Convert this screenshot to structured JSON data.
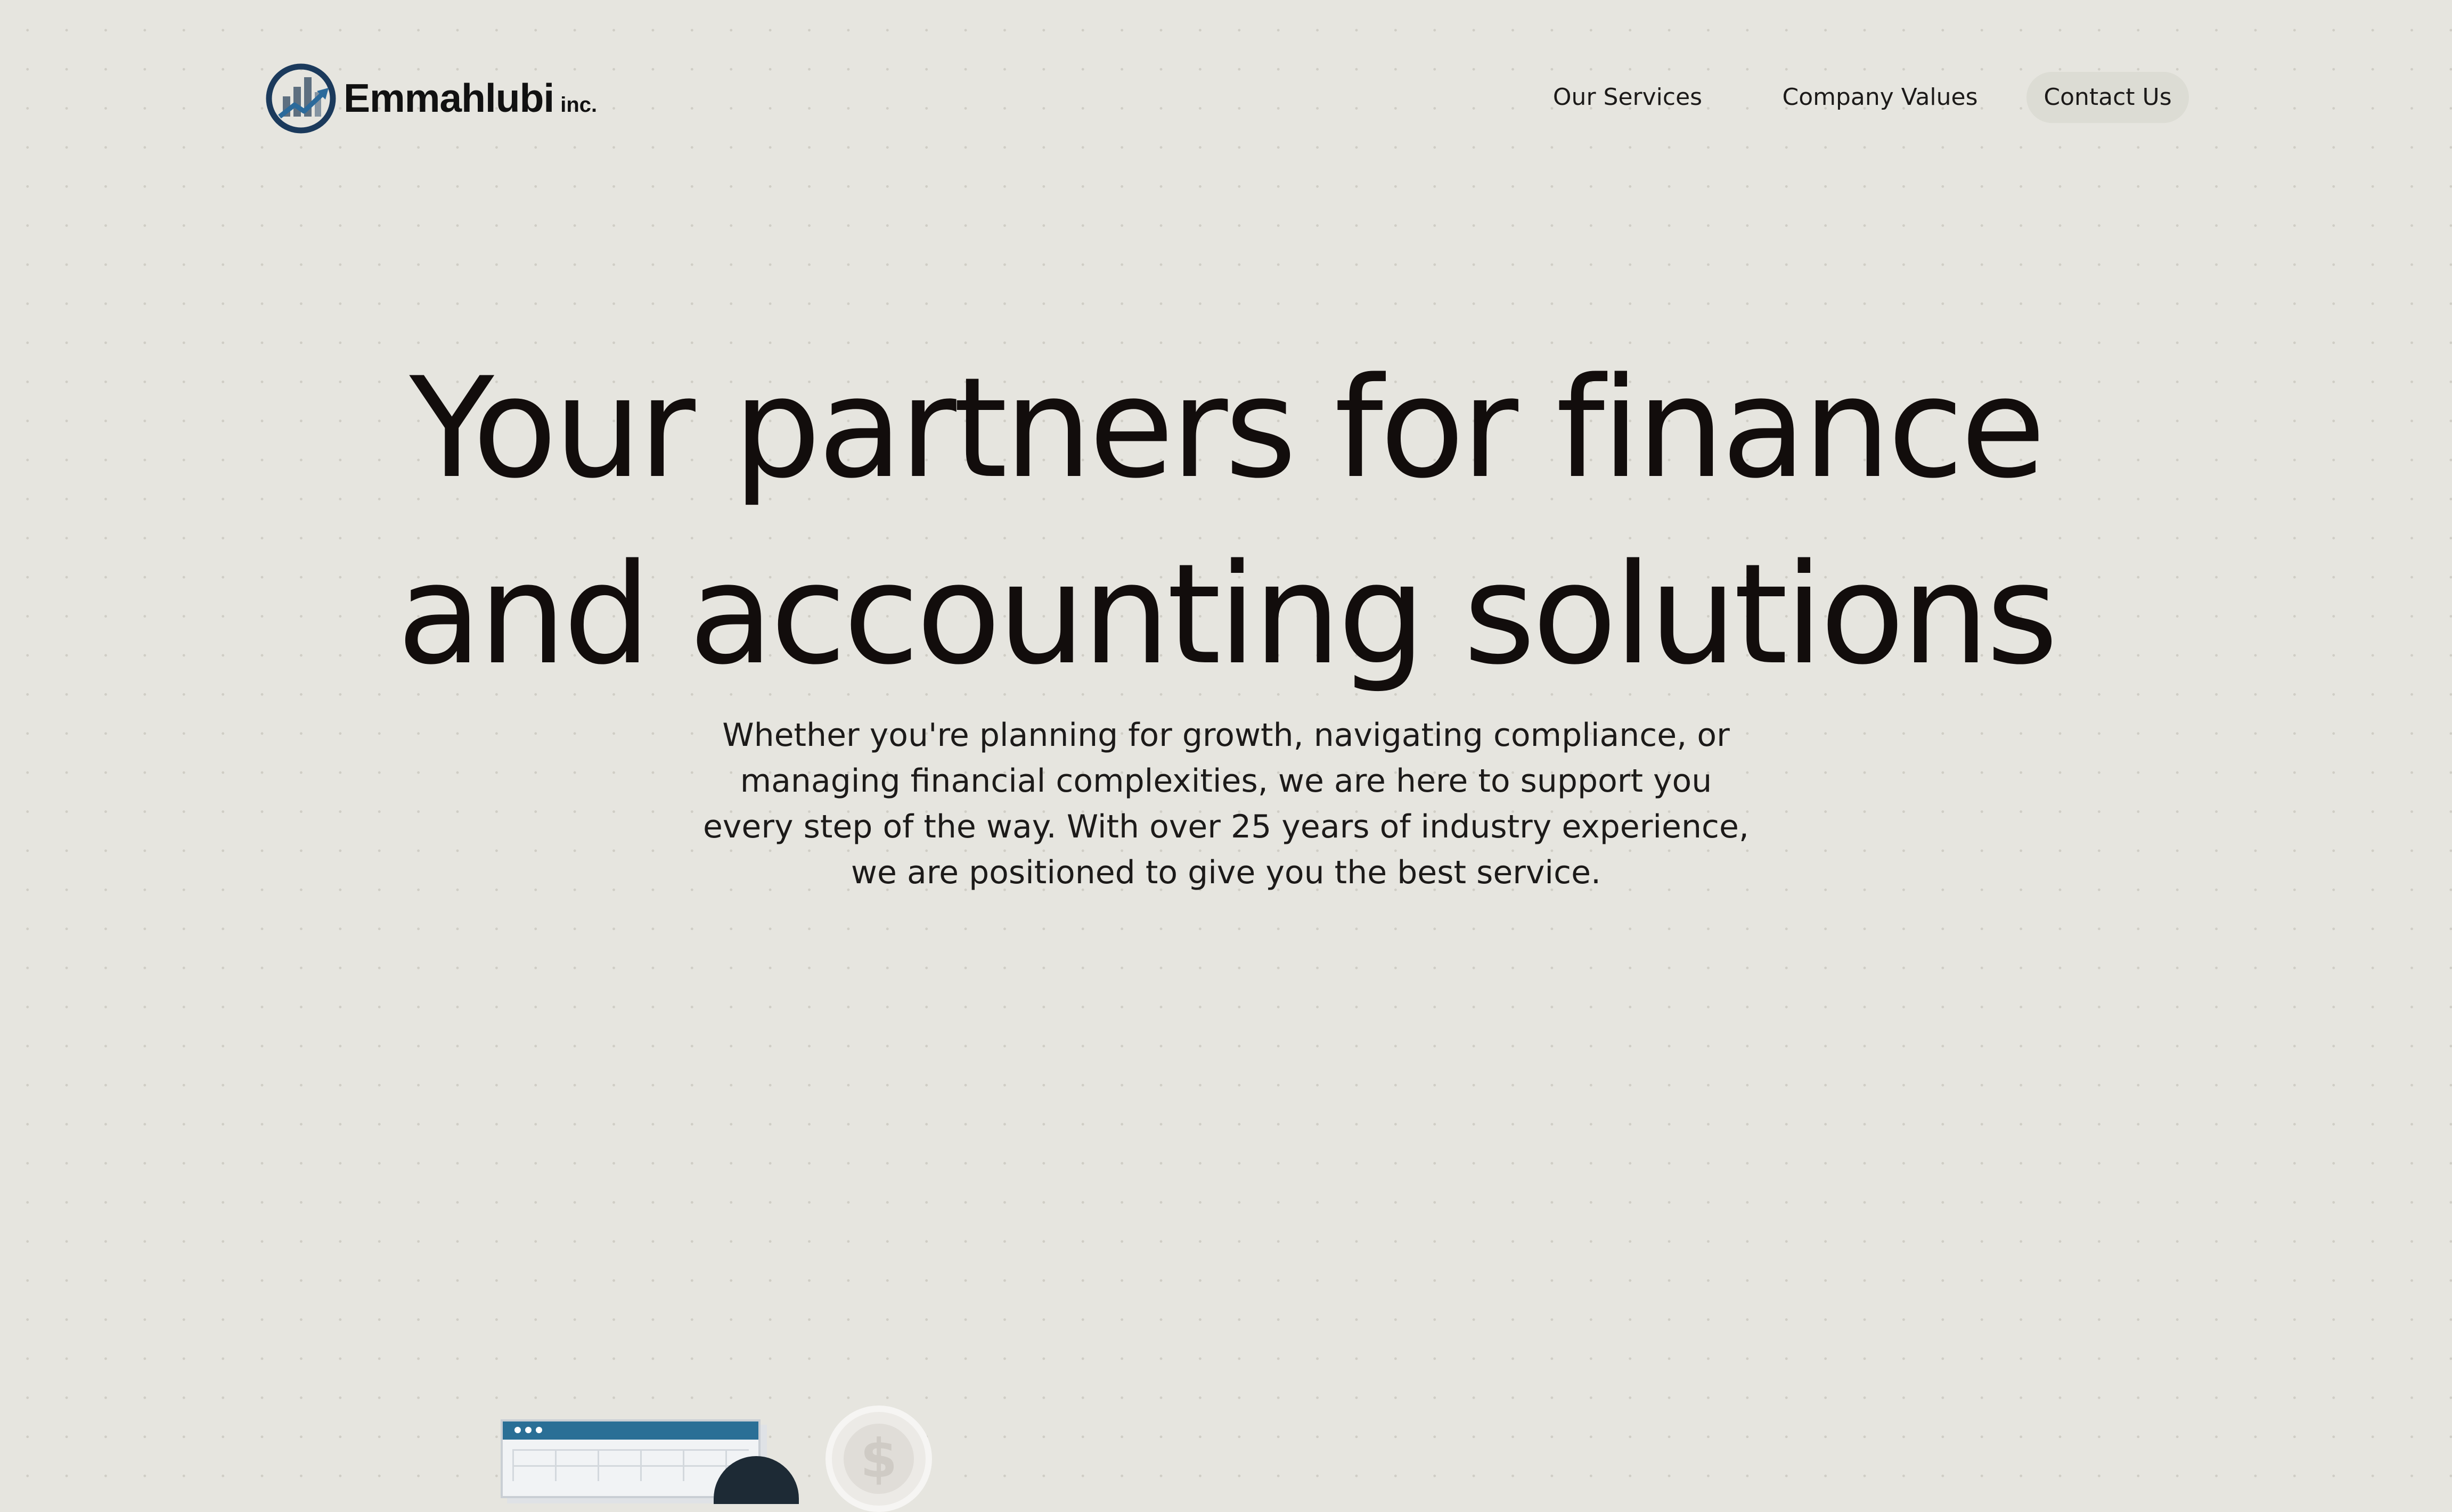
{
  "brand": {
    "name": "Emmahlubi",
    "suffix": "inc.",
    "colors": {
      "ring": "#1b3a5c",
      "bars": "#5d6f80",
      "arrow": "#2b6a9b"
    }
  },
  "nav": {
    "items": [
      {
        "label": "Our Services"
      },
      {
        "label": "Company Values"
      },
      {
        "label": "Contact Us",
        "highlighted": true
      }
    ]
  },
  "hero": {
    "title_line1": "Your partners for finance",
    "title_line2": "and accounting solutions",
    "subtitle": "Whether you're planning for growth, navigating compliance, or managing financial complexities, we are here to support you every step of the way. With over 25 years of industry experience, we are positioned to give you the best service."
  },
  "illustration": {
    "coin_symbol": "$",
    "icons": [
      "spreadsheet-icon",
      "dollar-coin-icon"
    ]
  },
  "theme": {
    "background": "#e6e5df",
    "text": "#120d0c",
    "pill": "#dcdcd4",
    "accent": "#2a6f96"
  }
}
